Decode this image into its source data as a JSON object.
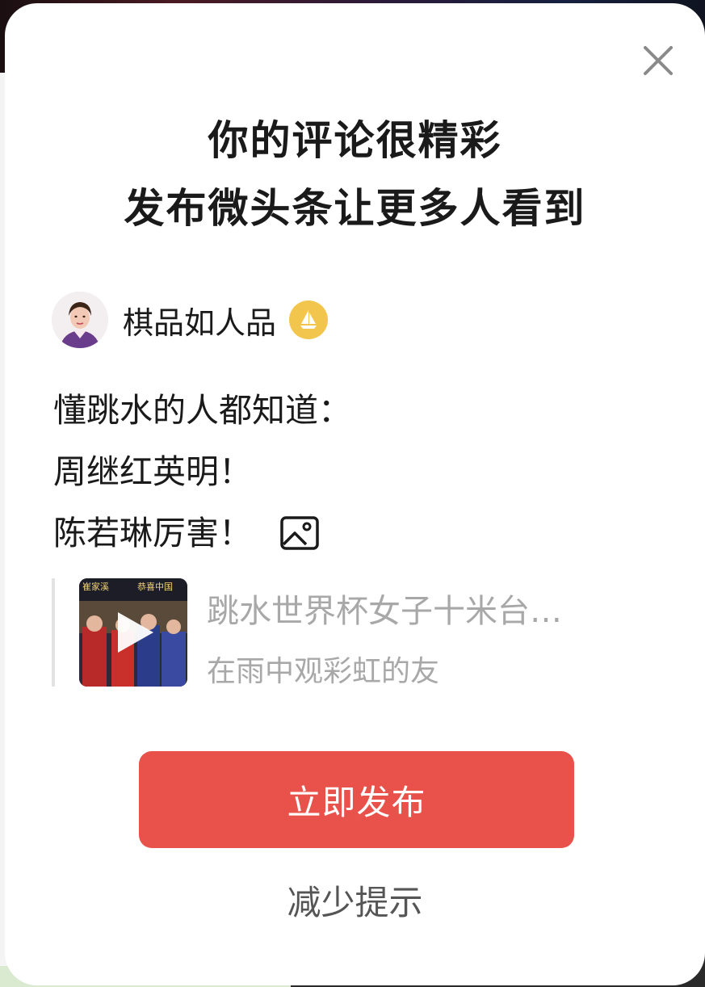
{
  "modal": {
    "headline": [
      "你的评论很精彩",
      "发布微头条让更多人看到"
    ],
    "close_icon": "close-icon"
  },
  "author": {
    "name": "棋品如人品",
    "badge_icon": "sailboat-badge-icon",
    "badge_color": "#f2c64d"
  },
  "comment": {
    "lines": [
      "懂跳水的人都知道：",
      "周继红英明！",
      "陈若琳厉害！"
    ],
    "attach_icon": "image-icon"
  },
  "quoted_video": {
    "title": "跳水世界杯女子十米台…",
    "source": "在雨中观彩虹的友",
    "thumb_caption": [
      "崔家溪",
      "恭喜中国"
    ],
    "play_icon": "play-icon"
  },
  "actions": {
    "publish_label": "立即发布",
    "publish_color": "#e9524a",
    "reduce_label": "减少提示"
  }
}
